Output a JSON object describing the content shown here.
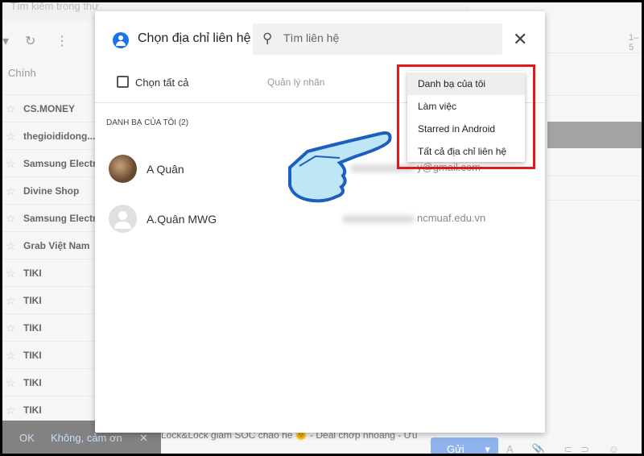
{
  "background": {
    "top_text": "Tìm kiếm trong thư",
    "tab": "Chính",
    "pager": "1–5",
    "rows": [
      "CS.MONEY",
      "thegioididong....",
      "Samsung Electro",
      "Divine Shop",
      "Samsung Electro",
      "Grab Việt Nam",
      "TIKI",
      "TIKI",
      "TIKI",
      "TIKI",
      "TIKI",
      "TIKI"
    ],
    "snackbar": {
      "ok": "OK",
      "no": "Không, cảm ơn",
      "close": "✕"
    },
    "subject": "Lock&Lock giảm SỐC chào hè 🌞 - Deal chớp nhoáng - Ưu",
    "send": "Gửi"
  },
  "dialog": {
    "title": "Chọn địa chỉ liên hệ",
    "search_placeholder": "Tìm liên hệ",
    "select_all": "Chọn tất cả",
    "manage_labels": "Quản lý nhãn",
    "section": "DANH BẠ CỦA TÔI (2)",
    "contacts": [
      {
        "name": "A Quân",
        "email": "y@gmail.com"
      },
      {
        "name": "A.Quân MWG",
        "email": "ncmuaf.edu.vn"
      }
    ],
    "menu": [
      "Danh bạ của tôi",
      "Làm việc",
      "Starred in Android",
      "Tất cả địa chỉ liên hệ"
    ],
    "menu_selected": "Danh bạ của tôi"
  },
  "colors": {
    "accent": "#1a73e8",
    "highlight": "#e0191b"
  }
}
